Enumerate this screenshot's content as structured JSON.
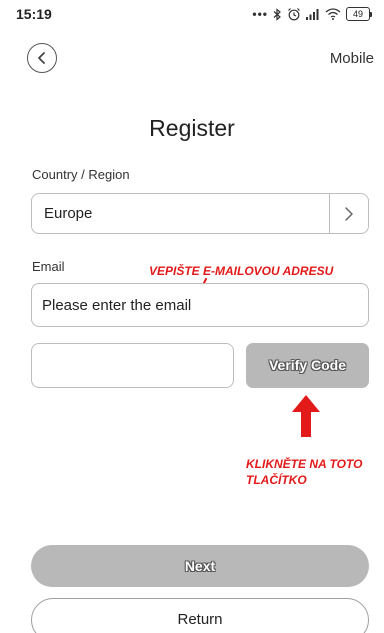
{
  "status_bar": {
    "time": "15:19",
    "battery": "49",
    "icons": [
      "dots-icon",
      "bluetooth-icon",
      "alarm-icon",
      "signal-icon",
      "wifi-icon",
      "battery-icon"
    ]
  },
  "header": {
    "back_icon": "chevron-left-icon",
    "mode_label": "Mobile"
  },
  "title": "Register",
  "country": {
    "label": "Country / Region",
    "value": "Europe",
    "arrow_icon": "chevron-right-icon"
  },
  "email": {
    "label": "Email",
    "placeholder": "Please enter the email"
  },
  "code": {
    "placeholder": "",
    "verify_label": "Verify Code"
  },
  "annotations": {
    "email_hint": "VEPIŠTE E-MAILOVOU ADRESU",
    "button_hint_line1": "KLIKNĚTE NA TOTO",
    "button_hint_line2": "TLAČÍTKO",
    "color": "#e21a1a"
  },
  "actions": {
    "next_label": "Next",
    "return_label": "Return"
  },
  "colors": {
    "disabled_button": "#b8b8b8",
    "border": "#bdbdbd"
  }
}
